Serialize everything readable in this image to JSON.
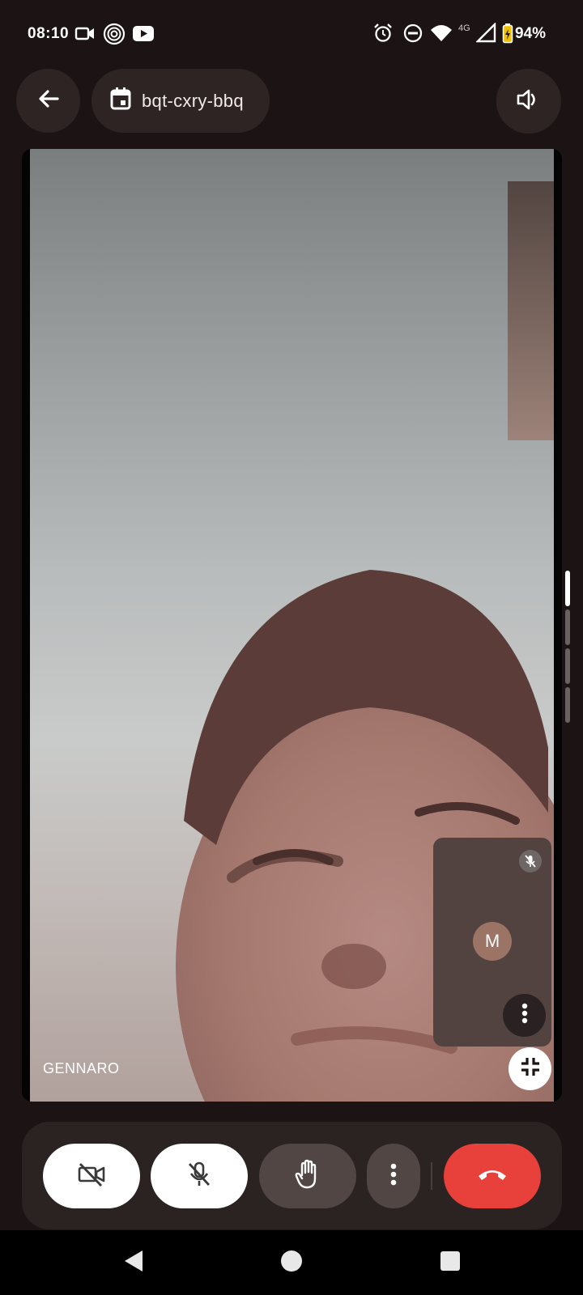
{
  "status_bar": {
    "time": "08:10",
    "network_label": "4G",
    "battery_percent": "94%",
    "left_icons": [
      "video-camera-icon",
      "fingerprint-app-icon",
      "youtube-icon"
    ],
    "right_icons": [
      "alarm-icon",
      "do-not-disturb-icon",
      "wifi-icon",
      "signal-icon",
      "battery-icon"
    ]
  },
  "top_bar": {
    "back_icon": "arrow-back-icon",
    "meeting_code": "bqt-cxry-bbq",
    "calendar_icon": "calendar-icon",
    "speaker_icon": "volume-up-icon"
  },
  "video": {
    "participant_name": "GENNARO"
  },
  "pip": {
    "avatar_initial": "M",
    "mic_muted": true,
    "more_icon": "more-vert-icon"
  },
  "controls": {
    "camera": {
      "icon": "videocam-off-icon",
      "state": "off"
    },
    "microphone": {
      "icon": "mic-off-icon",
      "state": "off"
    },
    "raise_hand": {
      "icon": "hand-icon"
    },
    "more": {
      "icon": "more-vert-icon"
    },
    "end_call": {
      "icon": "call-end-icon"
    }
  },
  "colors": {
    "background": "#1c1414",
    "end_call_red": "#e8413b",
    "control_bar": "#2b2222"
  }
}
